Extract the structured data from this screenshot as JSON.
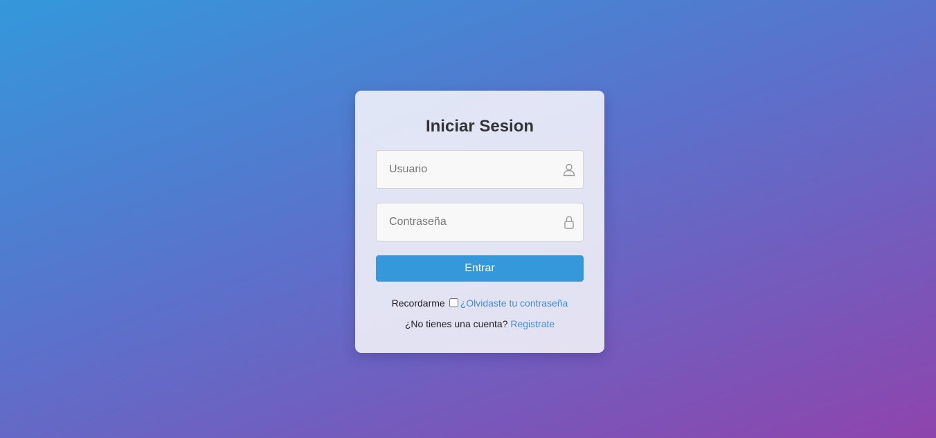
{
  "login": {
    "title": "Iniciar Sesion",
    "username_placeholder": "Usuario",
    "username_value": "",
    "password_placeholder": "Contraseña",
    "password_value": "",
    "submit_label": "Entrar",
    "remember_label": "Recordarme",
    "remember_checked": false,
    "forgot_link": "¿Olvidaste tu contraseña",
    "no_account_text": "¿No tienes una cuenta?",
    "register_link": "Registrate"
  },
  "icons": {
    "username": "user-icon",
    "password": "lock-icon"
  },
  "colors": {
    "background_start": "#3498db",
    "background_end": "#8e44ad",
    "accent": "#3498db",
    "link": "#3f8fd8",
    "title": "#333333"
  }
}
